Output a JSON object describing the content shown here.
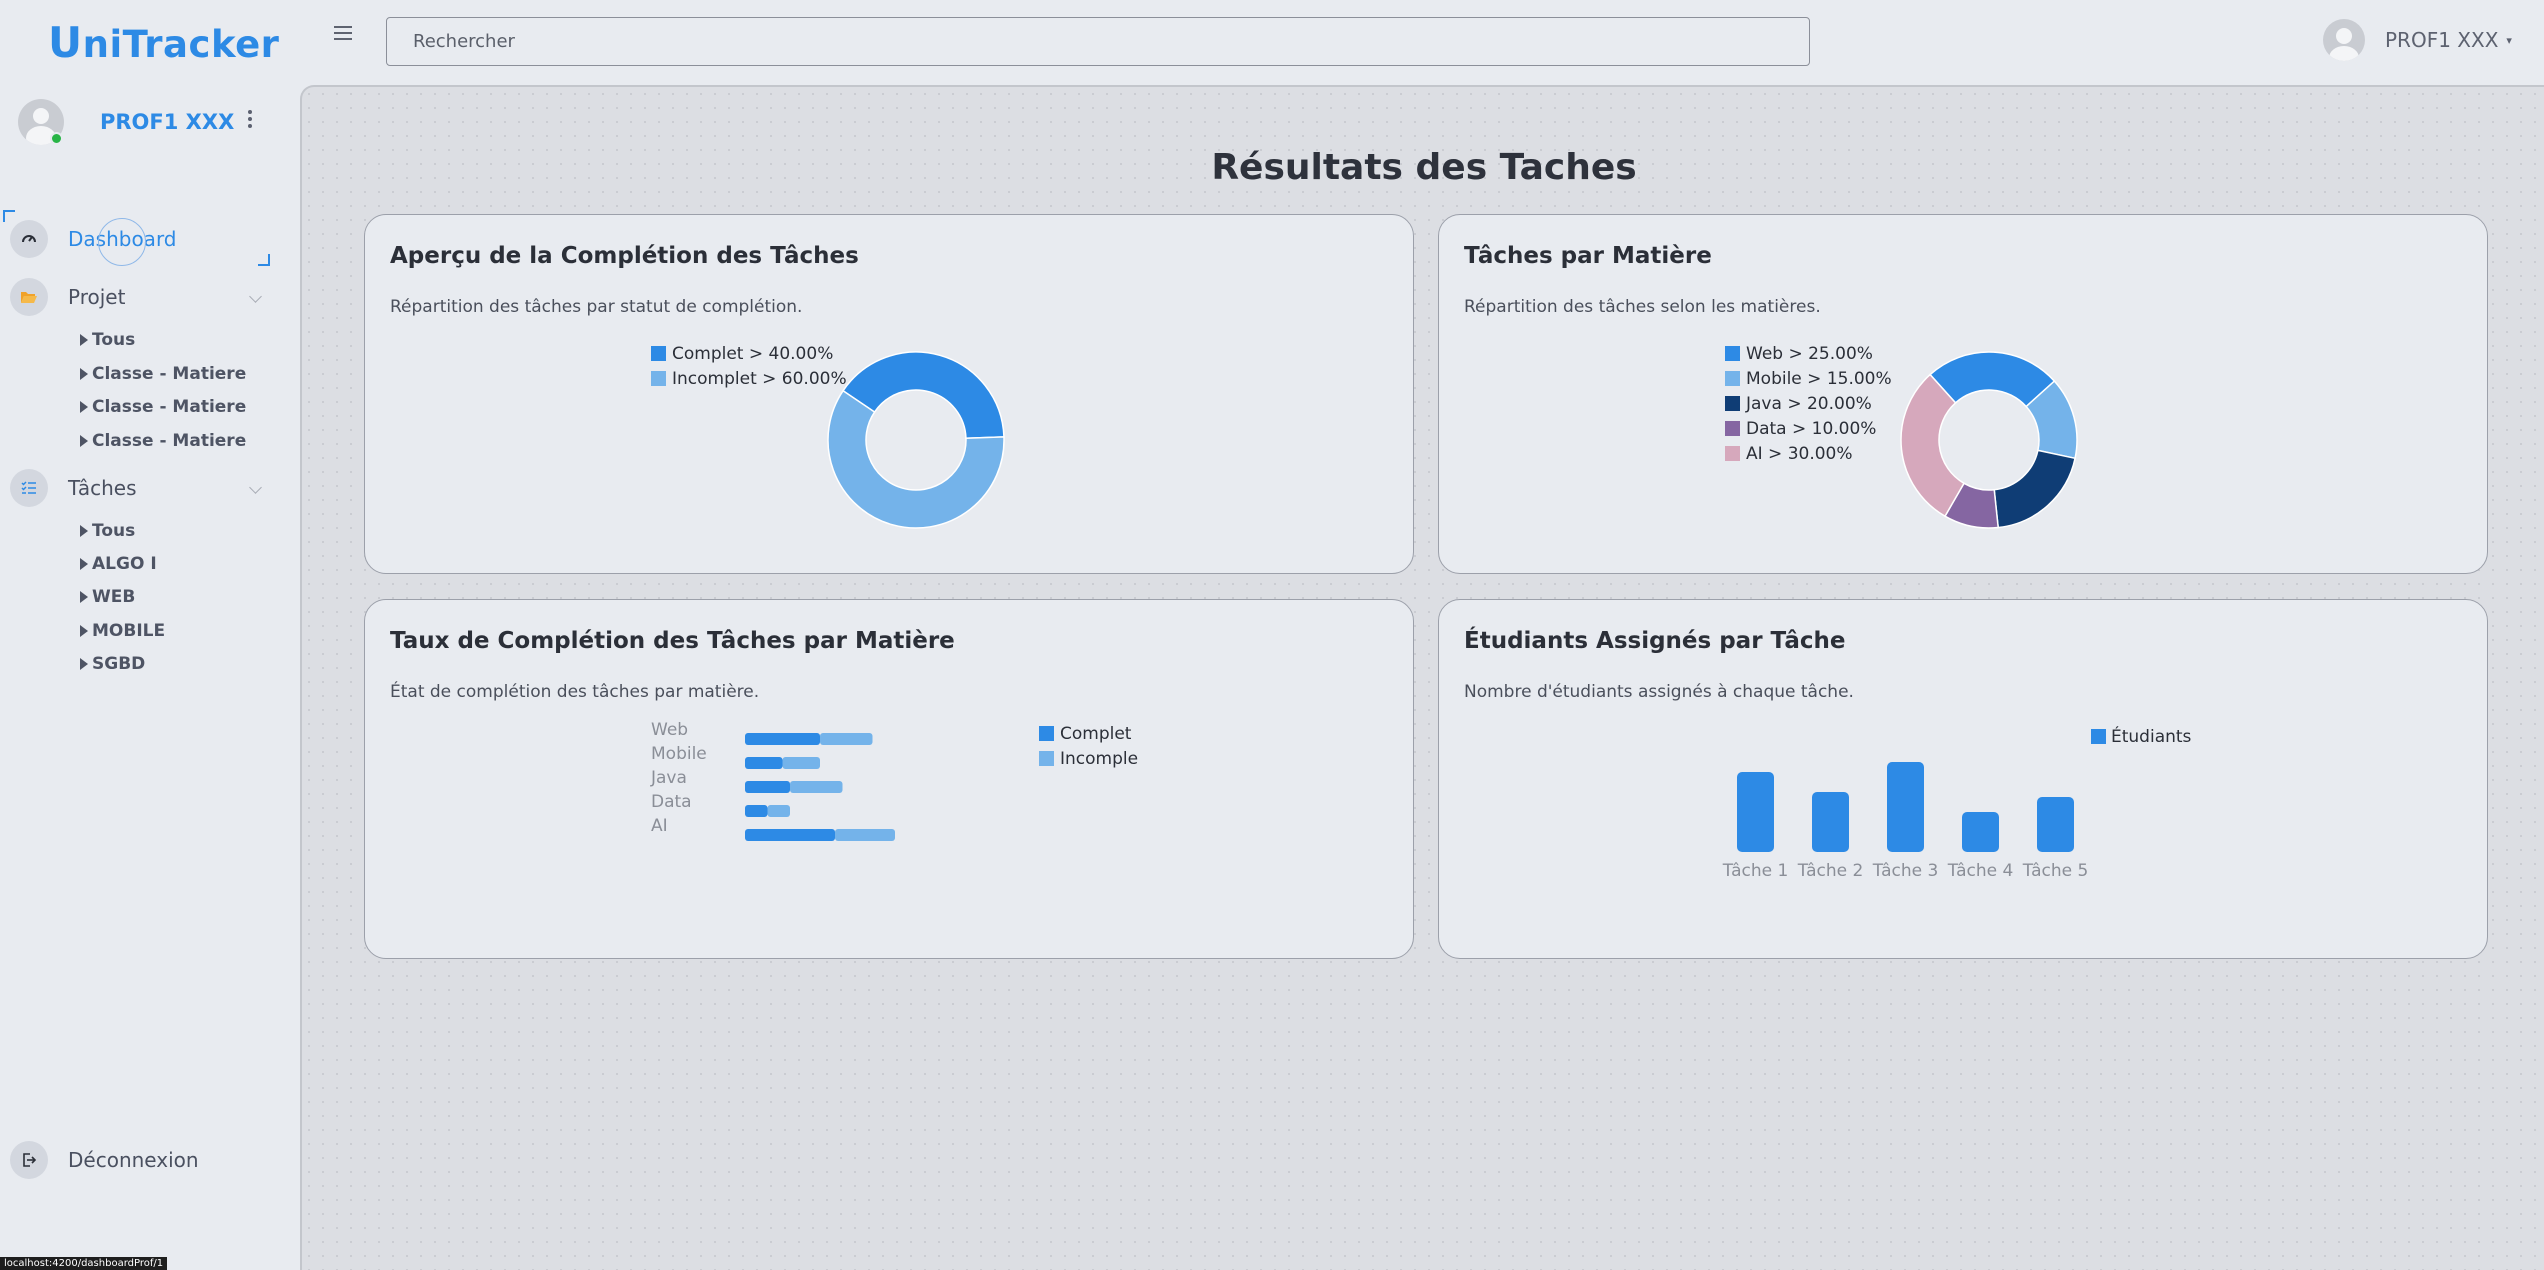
{
  "app": {
    "logo_first": "U",
    "logo_rest": "niTracker"
  },
  "search": {
    "placeholder": "Rechercher"
  },
  "user": {
    "name": "PROF1 XXX"
  },
  "sidebar": {
    "profile_name": "PROF1 XXX",
    "dashboard": "Dashboard",
    "projet": {
      "label": "Projet",
      "items": [
        "Tous",
        "Classe - Matiere",
        "Classe - Matiere",
        "Classe - Matiere"
      ]
    },
    "taches": {
      "label": "Tâches",
      "items": [
        "Tous",
        "ALGO I",
        "WEB",
        "MOBILE",
        "SGBD"
      ]
    },
    "logout": "Déconnexion"
  },
  "status_url": "localhost:4200/dashboardProf/1",
  "main": {
    "title": "Résultats des Taches"
  },
  "cards": {
    "completion": {
      "title": "Aperçu de la Complétion des Tâches",
      "subtitle": "Répartition des tâches par statut de complétion."
    },
    "subjects": {
      "title": "Tâches par Matière",
      "subtitle": "Répartition des tâches selon les matières."
    },
    "rate": {
      "title": "Taux de Complétion des Tâches par Matière",
      "subtitle": "État de complétion des tâches par matière."
    },
    "students": {
      "title": "Étudiants Assignés par Tâche",
      "subtitle": "Nombre d'étudiants assignés à chaque tâche."
    }
  },
  "colors": {
    "accent": "#2d8ae5",
    "light_blue": "#74b3ea",
    "navy": "#0f3d75",
    "purple": "#8566a2",
    "pink": "#d6a8bc"
  },
  "chart_data": [
    {
      "type": "pie",
      "variant": "doughnut",
      "legend_labels": [
        "Complet > 40.00%",
        "Incomplet > 60.00%"
      ],
      "labels": [
        "Complet",
        "Incomplet"
      ],
      "values": [
        40,
        60
      ],
      "colors": [
        "#2d8ae5",
        "#74b3ea"
      ]
    },
    {
      "type": "pie",
      "variant": "doughnut",
      "legend_labels": [
        "Web > 25.00%",
        "Mobile > 15.00%",
        "Java > 20.00%",
        "Data > 10.00%",
        "AI > 30.00%"
      ],
      "labels": [
        "Web",
        "Mobile",
        "Java",
        "Data",
        "AI"
      ],
      "values": [
        25,
        15,
        20,
        10,
        30
      ],
      "colors": [
        "#2d8ae5",
        "#74b3ea",
        "#0f3d75",
        "#8566a2",
        "#d6a8bc"
      ]
    },
    {
      "type": "bar",
      "orientation": "horizontal",
      "stacked": true,
      "categories": [
        "Web",
        "Mobile",
        "Java",
        "Data",
        "AI"
      ],
      "series": [
        {
          "name": "Complet",
          "values": [
            10,
            5,
            6,
            3,
            12
          ],
          "color": "#2d8ae5"
        },
        {
          "name": "Incomple",
          "values": [
            7,
            5,
            7,
            3,
            8
          ],
          "color": "#74b3ea"
        }
      ],
      "xlim": [
        0,
        30
      ],
      "legend": "right"
    },
    {
      "type": "bar",
      "categories": [
        "Tâche 1",
        "Tâche 2",
        "Tâche 3",
        "Tâche 4",
        "Tâche 5"
      ],
      "series": [
        {
          "name": "Étudiants",
          "values": [
            8,
            6,
            9,
            4,
            5.5
          ],
          "color": "#2d8ae5"
        }
      ],
      "ylim": [
        0,
        10
      ],
      "legend": "top-right"
    }
  ]
}
